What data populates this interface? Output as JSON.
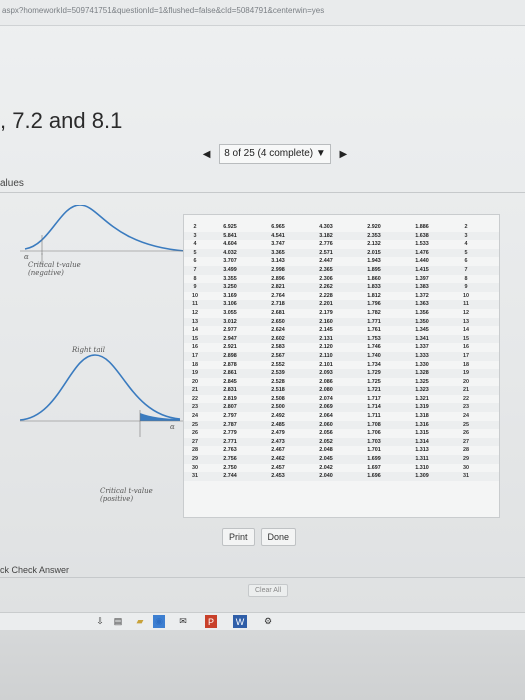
{
  "browser": {
    "url_fragment": "aspx?homeworkId=509741751&questionId=1&flushed=false&cId=5084791&centerwin=yes"
  },
  "page": {
    "title": ", 7.2 and 8.1"
  },
  "pager": {
    "prev": "◀",
    "status": "8 of 25 (4 complete) ▼",
    "next": "▶"
  },
  "section": {
    "label": "alues"
  },
  "figure": {
    "alpha_top": "α",
    "critical_negative": "Critical t-value (negative)",
    "right_tail": "Right tail",
    "alpha_bottom": "α",
    "critical_positive": "Critical t-value (positive)"
  },
  "table": {
    "headers": [
      "",
      "",
      "",
      "",
      "",
      "",
      ""
    ],
    "rows": [
      [
        "2",
        "6.925",
        "6.965",
        "4.303",
        "2.920",
        "1.886",
        "2"
      ],
      [
        "3",
        "5.841",
        "4.541",
        "3.182",
        "2.353",
        "1.638",
        "3"
      ],
      [
        "4",
        "4.604",
        "3.747",
        "2.776",
        "2.132",
        "1.533",
        "4"
      ],
      [
        "5",
        "4.032",
        "3.365",
        "2.571",
        "2.015",
        "1.476",
        "5"
      ],
      [
        "6",
        "3.707",
        "3.143",
        "2.447",
        "1.943",
        "1.440",
        "6"
      ],
      [
        "7",
        "3.499",
        "2.998",
        "2.365",
        "1.895",
        "1.415",
        "7"
      ],
      [
        "8",
        "3.355",
        "2.896",
        "2.306",
        "1.860",
        "1.397",
        "8"
      ],
      [
        "9",
        "3.250",
        "2.821",
        "2.262",
        "1.833",
        "1.383",
        "9"
      ],
      [
        "10",
        "3.169",
        "2.764",
        "2.228",
        "1.812",
        "1.372",
        "10"
      ],
      [
        "11",
        "3.106",
        "2.718",
        "2.201",
        "1.796",
        "1.363",
        "11"
      ],
      [
        "12",
        "3.055",
        "2.681",
        "2.179",
        "1.782",
        "1.356",
        "12"
      ],
      [
        "13",
        "3.012",
        "2.650",
        "2.160",
        "1.771",
        "1.350",
        "13"
      ],
      [
        "14",
        "2.977",
        "2.624",
        "2.145",
        "1.761",
        "1.345",
        "14"
      ],
      [
        "15",
        "2.947",
        "2.602",
        "2.131",
        "1.753",
        "1.341",
        "15"
      ],
      [
        "16",
        "2.921",
        "2.583",
        "2.120",
        "1.746",
        "1.337",
        "16"
      ],
      [
        "17",
        "2.898",
        "2.567",
        "2.110",
        "1.740",
        "1.333",
        "17"
      ],
      [
        "18",
        "2.878",
        "2.552",
        "2.101",
        "1.734",
        "1.330",
        "18"
      ],
      [
        "19",
        "2.861",
        "2.539",
        "2.093",
        "1.729",
        "1.328",
        "19"
      ],
      [
        "20",
        "2.845",
        "2.528",
        "2.086",
        "1.725",
        "1.325",
        "20"
      ],
      [
        "21",
        "2.831",
        "2.518",
        "2.080",
        "1.721",
        "1.323",
        "21"
      ],
      [
        "22",
        "2.819",
        "2.508",
        "2.074",
        "1.717",
        "1.321",
        "22"
      ],
      [
        "23",
        "2.807",
        "2.500",
        "2.069",
        "1.714",
        "1.319",
        "23"
      ],
      [
        "24",
        "2.797",
        "2.492",
        "2.064",
        "1.711",
        "1.318",
        "24"
      ],
      [
        "25",
        "2.787",
        "2.485",
        "2.060",
        "1.708",
        "1.316",
        "25"
      ],
      [
        "26",
        "2.779",
        "2.479",
        "2.056",
        "1.706",
        "1.315",
        "26"
      ],
      [
        "27",
        "2.771",
        "2.473",
        "2.052",
        "1.703",
        "1.314",
        "27"
      ],
      [
        "28",
        "2.763",
        "2.467",
        "2.048",
        "1.701",
        "1.313",
        "28"
      ],
      [
        "29",
        "2.756",
        "2.462",
        "2.045",
        "1.699",
        "1.311",
        "29"
      ],
      [
        "30",
        "2.750",
        "2.457",
        "2.042",
        "1.697",
        "1.310",
        "30"
      ],
      [
        "31",
        "2.744",
        "2.453",
        "2.040",
        "1.696",
        "1.309",
        "31"
      ]
    ]
  },
  "buttons": {
    "print": "Print",
    "done": "Done"
  },
  "footer": {
    "check_answer": "ck Check Answer",
    "clear_all": "Clear All"
  },
  "taskbar": {
    "icon_labels": [
      "⇩",
      "▤",
      "▰",
      "◉",
      "✉",
      "P",
      "W",
      "⚙"
    ]
  }
}
